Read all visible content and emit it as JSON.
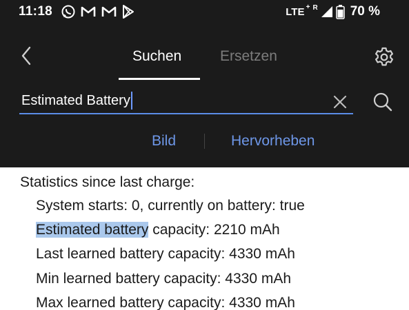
{
  "status_bar": {
    "time": "11:18",
    "network": "LTE",
    "network_plus": "+",
    "roaming": "R",
    "battery_percent": "70 %",
    "battery_level": 0.7,
    "notification_icons": [
      "whatsapp-icon",
      "gmail-icon",
      "gmail-icon",
      "play-store-icon"
    ]
  },
  "header": {
    "tabs": [
      {
        "label": "Suchen",
        "active": true
      },
      {
        "label": "Ersetzen",
        "active": false
      }
    ]
  },
  "search": {
    "value": "Estimated Battery"
  },
  "options": {
    "image_label": "Bild",
    "highlight_label": "Hervorheben"
  },
  "document": {
    "heading": "Statistics since last charge:",
    "lines": [
      {
        "text": "System starts: 0, currently on battery: true"
      },
      {
        "highlight": "Estimated battery",
        "rest": " capacity: 2210 mAh"
      },
      {
        "text": "Last learned battery capacity: 4330 mAh"
      },
      {
        "text": "Min learned battery capacity: 4330 mAh"
      },
      {
        "text": "Max learned battery capacity: 4330 mAh"
      }
    ]
  },
  "colors": {
    "background_dark": "#1b1b1b",
    "accent_blue": "#6e97e8",
    "highlight": "#aac8ec"
  }
}
